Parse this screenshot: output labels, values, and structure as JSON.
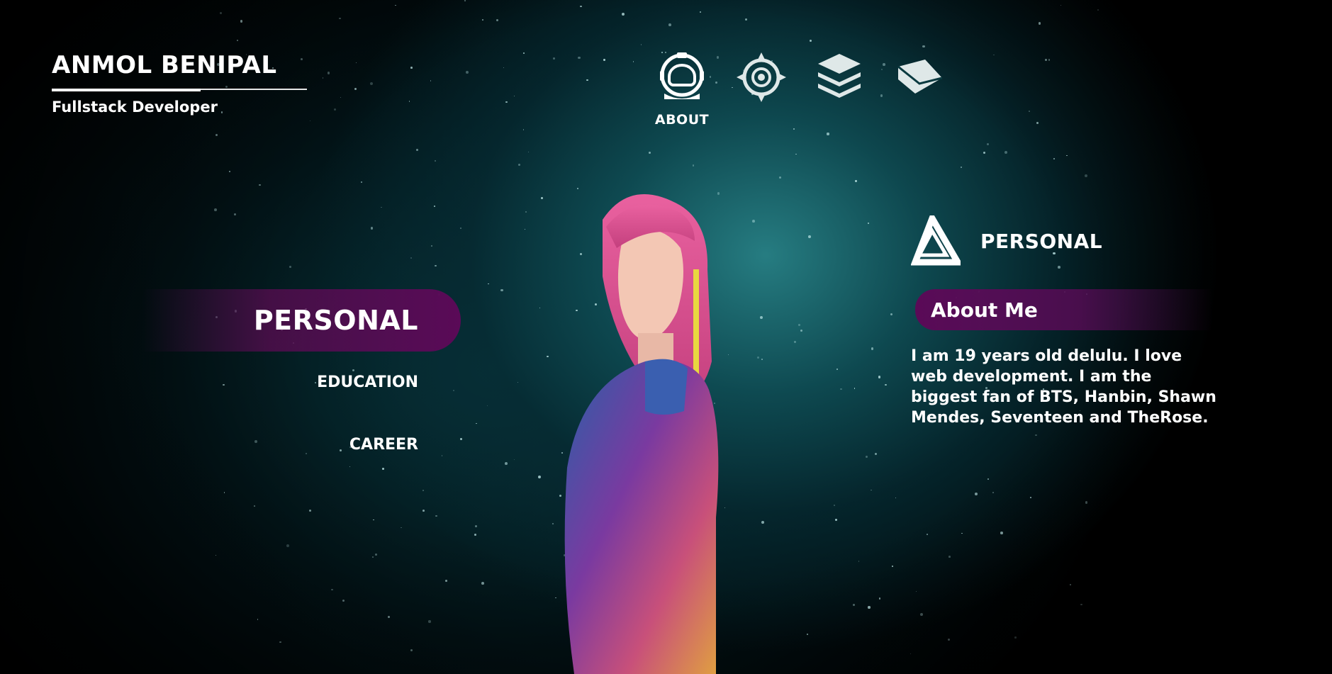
{
  "brand": {
    "name": "ANMOL BENIPAL",
    "role": "Fullstack Developer"
  },
  "topnav": {
    "items": [
      {
        "icon": "astronaut-helmet-icon",
        "label": "ABOUT",
        "active": true
      },
      {
        "icon": "target-eye-icon",
        "label": "",
        "active": false
      },
      {
        "icon": "layers-stack-icon",
        "label": "",
        "active": false
      },
      {
        "icon": "envelope-icon",
        "label": "",
        "active": false
      }
    ]
  },
  "sidebar": {
    "active": "PERSONAL",
    "items": [
      "PERSONAL",
      "EDUCATION",
      "CAREER"
    ]
  },
  "panel": {
    "icon": "impossible-triangle-icon",
    "heading": "PERSONAL",
    "about_title": "About Me",
    "about_text": "I am 19 years old delulu. I love web development. I am the biggest fan of BTS, Hanbin, Shawn Mendes, Seventeen and TheRose."
  },
  "colors": {
    "accent_purple": "#5a0a57",
    "background_teal": "#0f5258"
  }
}
